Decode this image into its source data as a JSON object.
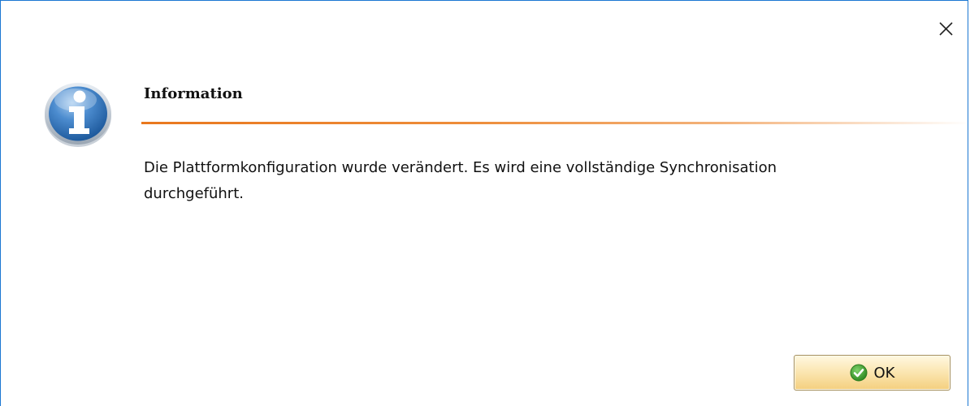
{
  "dialog": {
    "close_icon": "close-icon",
    "icon": "info-icon",
    "heading": "Information",
    "message": "Die Plattformkonfiguration wurde verändert. Es wird eine vollständige Synchronisation\ndurchgeführt.",
    "ok_button": {
      "label": "OK",
      "icon": "check-circle-icon"
    },
    "colors": {
      "border": "#1b77d2",
      "accent_rule": "#e9781e",
      "info_blue": "#2f6fb3",
      "ok_green": "#3a9d2a"
    }
  }
}
